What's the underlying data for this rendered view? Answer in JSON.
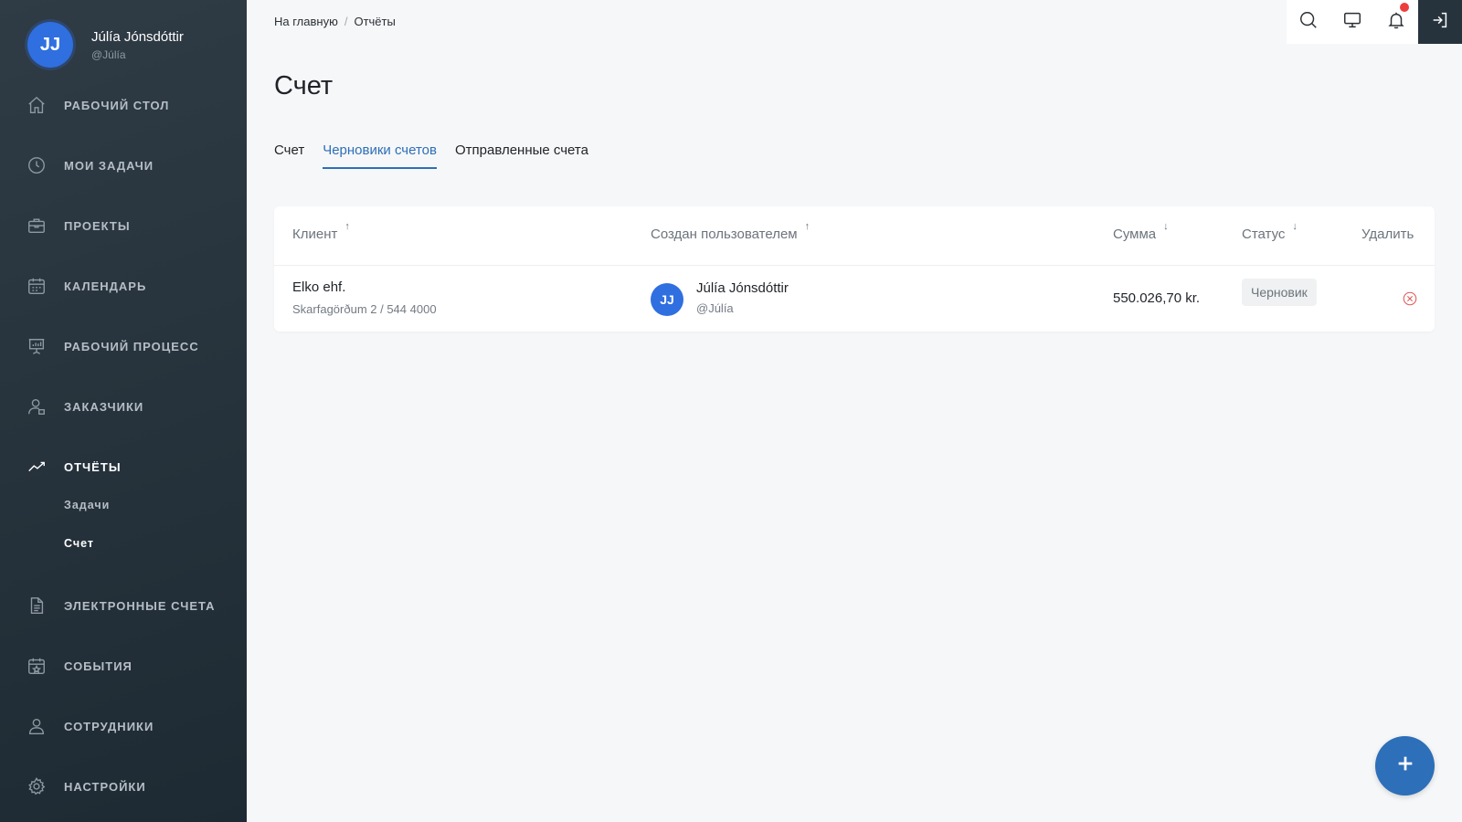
{
  "user": {
    "initials": "JJ",
    "name": "Júlía Jónsdóttir",
    "handle": "@Júlía"
  },
  "sidebar": {
    "items": [
      {
        "label": "Рабочий стол",
        "icon": "home-icon"
      },
      {
        "label": "Мои задачи",
        "icon": "clock-icon"
      },
      {
        "label": "Проекты",
        "icon": "briefcase-icon"
      },
      {
        "label": "Календарь",
        "icon": "calendar-icon"
      },
      {
        "label": "Рабочий процесс",
        "icon": "presentation-icon"
      },
      {
        "label": "Заказчики",
        "icon": "customer-icon"
      },
      {
        "label": "Отчёты",
        "icon": "trend-icon"
      },
      {
        "label": "Электронные счета",
        "icon": "document-icon"
      },
      {
        "label": "События",
        "icon": "calendar-star-icon"
      },
      {
        "label": "Сотрудники",
        "icon": "users-icon"
      },
      {
        "label": "Настройки",
        "icon": "gear-icon"
      }
    ],
    "reports_sub": [
      "Задачи",
      "Счет"
    ]
  },
  "breadcrumb": {
    "home": "На главную",
    "current": "Отчёты"
  },
  "page": {
    "title": "Счет"
  },
  "tabs": [
    "Счет",
    "Черновики счетов",
    "Отправленные счета"
  ],
  "table": {
    "headers": {
      "client": "Клиент",
      "creator": "Создан пользователем",
      "amount": "Сумма",
      "status": "Статус",
      "delete": "Удалить"
    },
    "rows": [
      {
        "client": "Elko ehf.",
        "address": "Skarfagörðum 2 / 544 4000",
        "creator_initials": "JJ",
        "creator_name": "Júlía Jónsdóttir",
        "creator_handle": "@Júlía",
        "amount": "550.026,70 kr.",
        "status": "Черновик"
      }
    ]
  },
  "colors": {
    "accent": "#2d6fb8",
    "avatar": "#2f6fe0",
    "sidebar": "#27333c",
    "danger": "#e05656"
  }
}
